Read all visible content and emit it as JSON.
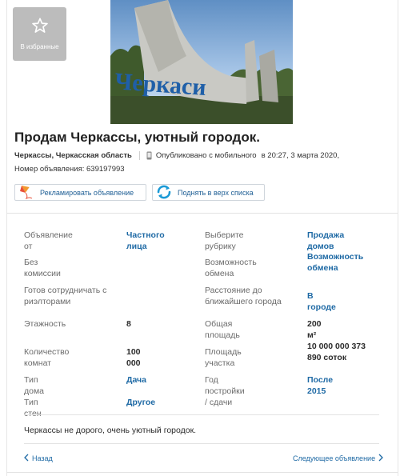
{
  "favorites": {
    "label": "В избранные",
    "icon": "star-outline-icon"
  },
  "photo": {
    "caption": "Черкаси"
  },
  "listing": {
    "title": "Продам Черкассы, уютный городок.",
    "location": "Черкассы, Черкасская область",
    "published": "Опубликовано с мобильного",
    "published_time": "в 20:27, 3 марта 2020,",
    "ad_number": "Номер объявления: 639197993"
  },
  "actions": {
    "advertise": "Рекламировать объявление",
    "raise": "Поднять в верх списка"
  },
  "params": {
    "rows": [
      {
        "l1": "Объявление от",
        "v1": "Частного лица",
        "l2": "Выберите рубрику",
        "v2": "Продажа домов"
      },
      {
        "l1": "Без комиссии",
        "v1": "",
        "l2": "Возможность обмена",
        "v2": "Возможность обмена"
      },
      {
        "l1": "Готов сотрудничать с риэлторами",
        "v1": "",
        "l2": "Расстояние до ближайшего города",
        "v2": "В городе"
      },
      {
        "l1": "Этажность",
        "v1": "8",
        "l2": "Общая площадь",
        "v2": "200 м²"
      },
      {
        "l1": "Количество комнат",
        "v1": "100 000",
        "l2": "Площадь участка",
        "v2": "10 000 000 373 890 соток"
      },
      {
        "l1": "Тип дома",
        "v1": "Дача",
        "l2": "Год постройки / сдачи",
        "v2": "После 2015"
      },
      {
        "l1": "Тип стен",
        "v1": "Другое",
        "l2": "",
        "v2": ""
      }
    ]
  },
  "description": "Черкассы не дорого, очень уютный городок.",
  "navigation": {
    "back": "Назад",
    "next": "Следующее объявление"
  },
  "colors": {
    "link": "#1f6aa5",
    "favorites_bg": "#bcbcbc",
    "sky": "#7aa7d6"
  }
}
